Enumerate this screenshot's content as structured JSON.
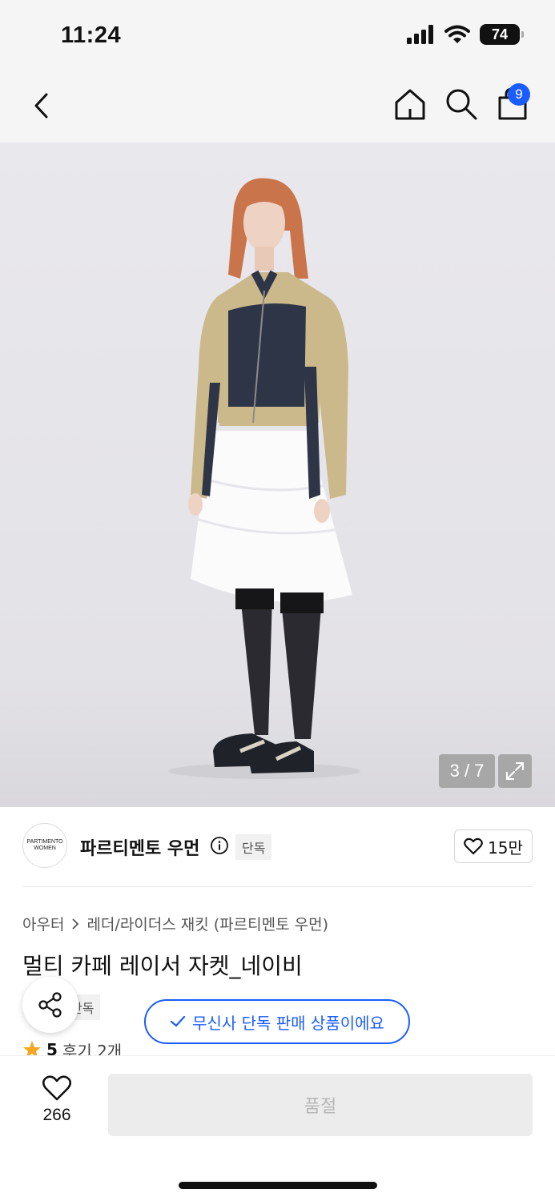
{
  "status_bar": {
    "time": "11:24",
    "battery": "74"
  },
  "nav": {
    "cart_count": "9"
  },
  "gallery": {
    "counter": "3 / 7"
  },
  "brand": {
    "logo_line1": "PARTIMENTO",
    "logo_line2": "WOMEN",
    "name": "파르티멘토 우먼",
    "tag": "단독",
    "likes": "15만"
  },
  "product": {
    "category": "아우터",
    "subcategory": "레더/라이더스 재킷 (파르티멘토 우먼)",
    "title": "멀티 카페 레이서 자켓_네이비",
    "exclusive_tag": "단독",
    "exclusive_notice": "무신사 단독 판매 상품이에요",
    "rating": "5",
    "reviews": "후기 2개"
  },
  "bottom_bar": {
    "wish_count": "266",
    "buy_label": "품절"
  },
  "colors": {
    "accent": "#1a5cff",
    "rating_star": "#f5a623"
  }
}
